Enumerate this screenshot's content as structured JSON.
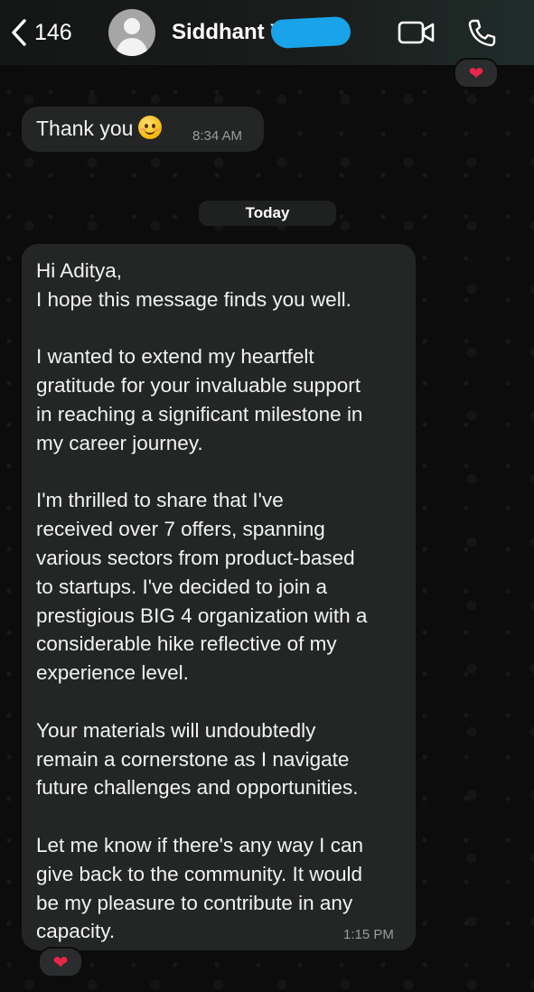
{
  "header": {
    "back_count": "146",
    "contact_name": "Siddhant Y",
    "icons": {
      "back": "chevron-left-icon",
      "video": "video-call-icon",
      "phone": "phone-call-icon"
    }
  },
  "messages": [
    {
      "text": "Thank you",
      "emoji": "smiling-face-icon",
      "time": "8:34 AM"
    }
  ],
  "date_separator": "Today",
  "long_message": {
    "lines": [
      "Hi Aditya,",
      "I hope this message finds you well.",
      "",
      "I wanted to extend my heartfelt",
      "gratitude for your invaluable support",
      "in reaching a significant milestone in",
      "my career journey.",
      "",
      "I'm thrilled to share that I've",
      "received over 7 offers, spanning",
      "various sectors from product-based",
      "to startups. I've decided to join a",
      "prestigious BIG 4 organization with a",
      "considerable hike reflective of my",
      "experience level.",
      "",
      "Your materials will undoubtedly",
      "remain a cornerstone as I navigate",
      "future challenges and opportunities.",
      "",
      "Let me know if there's any way I can",
      "give back to the community. It would",
      "be my pleasure to contribute in any",
      "capacity."
    ],
    "time": "1:15 PM"
  },
  "reactions": {
    "top": "❤",
    "bottom": "❤"
  },
  "colors": {
    "reaction_heart": "#e8264a",
    "bubble": "#242626",
    "redaction": "#19a3e8"
  }
}
